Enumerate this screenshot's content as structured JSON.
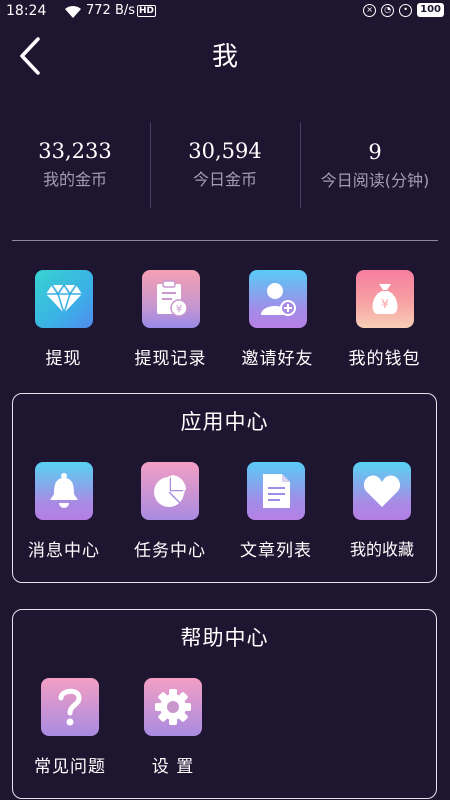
{
  "status_bar": {
    "time": "18:24",
    "speed": "772 B/s",
    "hd": "HD",
    "battery": "100"
  },
  "header": {
    "title": "我"
  },
  "stats": [
    {
      "value": "33,233",
      "label": "我的金币"
    },
    {
      "value": "30,594",
      "label": "今日金币"
    },
    {
      "value": "9",
      "label": "今日阅读(分钟)"
    }
  ],
  "quick_actions": [
    {
      "label": "提现",
      "icon": "diamond-icon"
    },
    {
      "label": "提现记录",
      "icon": "withdraw-record-icon"
    },
    {
      "label": "邀请好友",
      "icon": "invite-friend-icon"
    },
    {
      "label": "我的钱包",
      "icon": "money-bag-icon"
    }
  ],
  "app_center": {
    "title": "应用中心",
    "items": [
      {
        "label": "消息中心",
        "icon": "bell-icon"
      },
      {
        "label": "任务中心",
        "icon": "pie-chart-icon"
      },
      {
        "label": "文章列表",
        "icon": "document-icon"
      },
      {
        "label": "我的收藏",
        "icon": "heart-icon"
      }
    ]
  },
  "help_center": {
    "title": "帮助中心",
    "items": [
      {
        "label": "常见问题",
        "icon": "question-icon"
      },
      {
        "label": "设 置",
        "icon": "gear-icon"
      }
    ]
  },
  "colors": {
    "background": "#1e1630",
    "label_muted": "#a49cb3"
  }
}
